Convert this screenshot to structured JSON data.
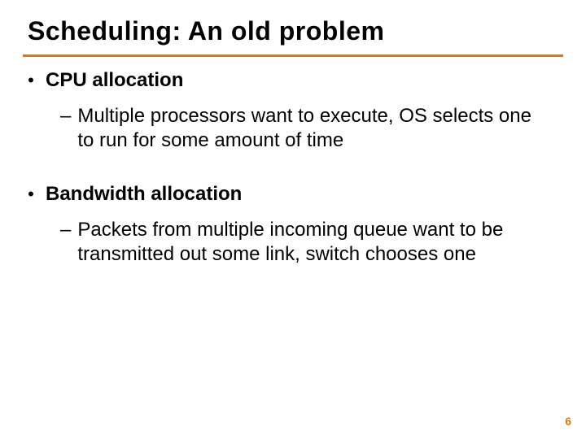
{
  "title": "Scheduling:  An old problem",
  "bullets": [
    {
      "label": "CPU allocation",
      "sub": "Multiple processors want to execute, OS selects one to run for some amount of time"
    },
    {
      "label": "Bandwidth allocation",
      "sub": "Packets from multiple incoming queue want to be transmitted out some link, switch chooses one"
    }
  ],
  "page_number": "6"
}
